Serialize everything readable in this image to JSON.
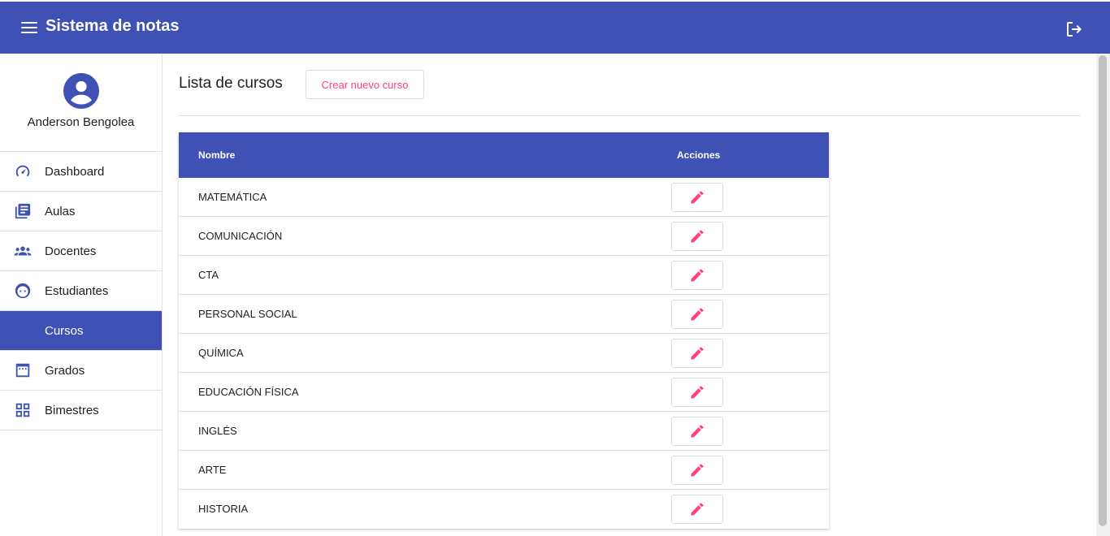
{
  "app": {
    "title": "Sistema de notas"
  },
  "user": {
    "name": "Anderson Bengolea"
  },
  "sidebar": {
    "items": [
      {
        "label": "Dashboard",
        "icon": "speedometer-icon",
        "active": false
      },
      {
        "label": "Aulas",
        "icon": "library-books-icon",
        "active": false
      },
      {
        "label": "Docentes",
        "icon": "people-icon",
        "active": false
      },
      {
        "label": "Estudiantes",
        "icon": "child-face-icon",
        "active": false
      },
      {
        "label": "Cursos",
        "icon": "",
        "active": true
      },
      {
        "label": "Grados",
        "icon": "calendar-view-icon",
        "active": false
      },
      {
        "label": "Bimestres",
        "icon": "grid-view-icon",
        "active": false
      }
    ]
  },
  "main": {
    "title": "Lista de cursos",
    "create_label": "Crear nuevo curso"
  },
  "table": {
    "columns": [
      "Nombre",
      "Acciones"
    ],
    "rows": [
      "MATEMÁTICA",
      "COMUNICACIÓN",
      "CTA",
      "PERSONAL SOCIAL",
      "QUÍMICA",
      "EDUCACIÓN FÍSICA",
      "INGLÉS",
      "ARTE",
      "HISTORIA"
    ]
  },
  "colors": {
    "primary": "#3f51b5",
    "accent": "#ff4081"
  }
}
